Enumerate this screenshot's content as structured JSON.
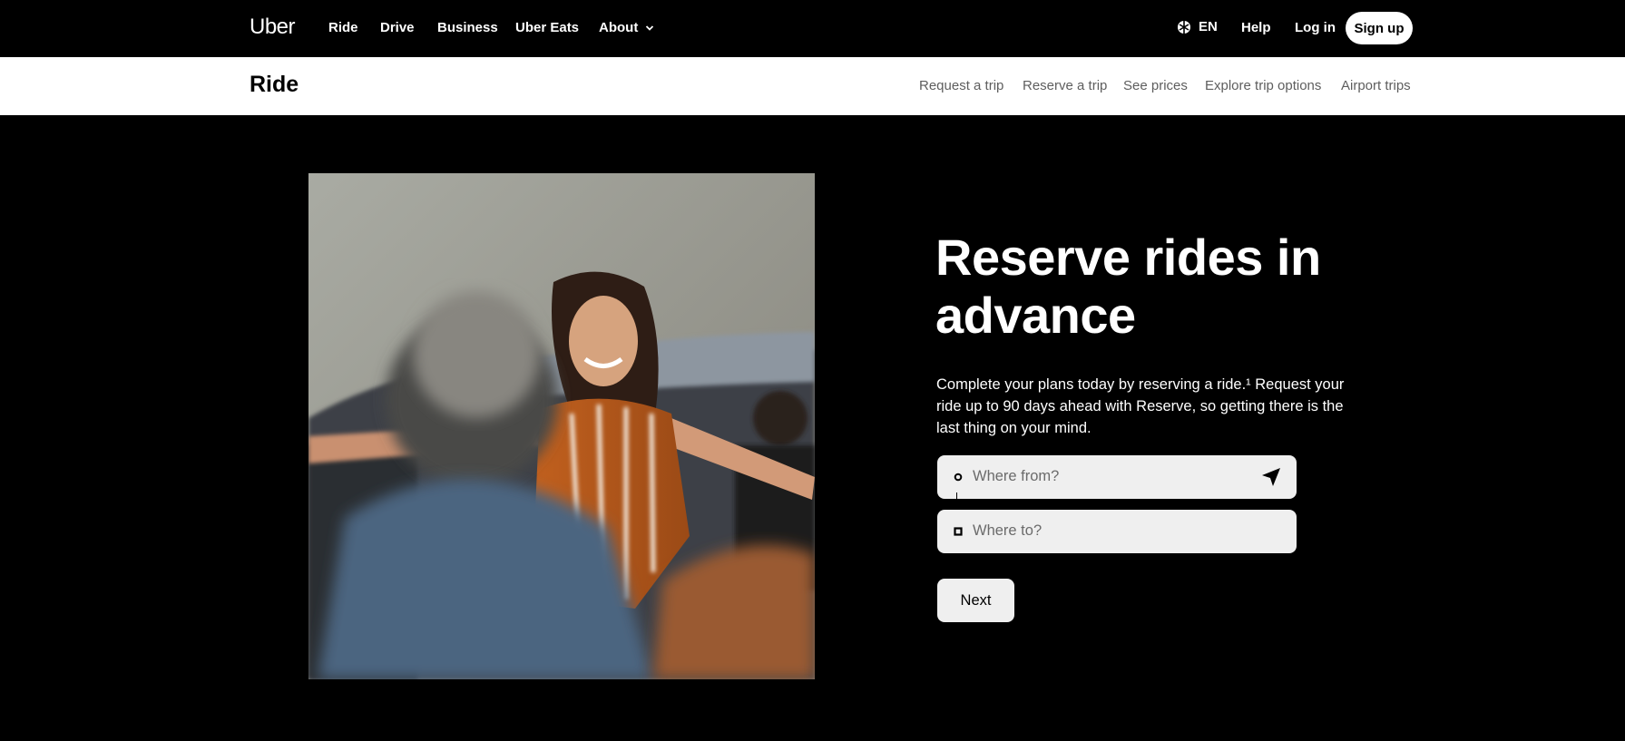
{
  "topnav": {
    "logo": "Uber",
    "links": [
      "Ride",
      "Drive",
      "Business",
      "Uber Eats"
    ],
    "about": "About",
    "language": "EN",
    "help": "Help",
    "login": "Log in",
    "signup": "Sign up"
  },
  "subnav": {
    "title": "Ride",
    "links": [
      "Request a trip",
      "Reserve a trip",
      "See prices",
      "Explore trip options",
      "Airport trips"
    ]
  },
  "hero": {
    "headline": "Reserve rides in advance",
    "description": "Complete your plans today by reserving a ride.¹ Request your ride up to 90 days ahead with Reserve, so getting there is the last thing on your mind.",
    "from_placeholder": "Where from?",
    "to_placeholder": "Where to?",
    "next_label": "Next"
  },
  "colors": {
    "background": "#000000",
    "subnav_bg": "#ffffff",
    "input_bg": "#efefef",
    "muted_text": "#5e5e5e"
  },
  "icons": [
    "chevron-down-icon",
    "globe-icon",
    "origin-dot-icon",
    "destination-square-icon",
    "location-arrow-icon"
  ]
}
